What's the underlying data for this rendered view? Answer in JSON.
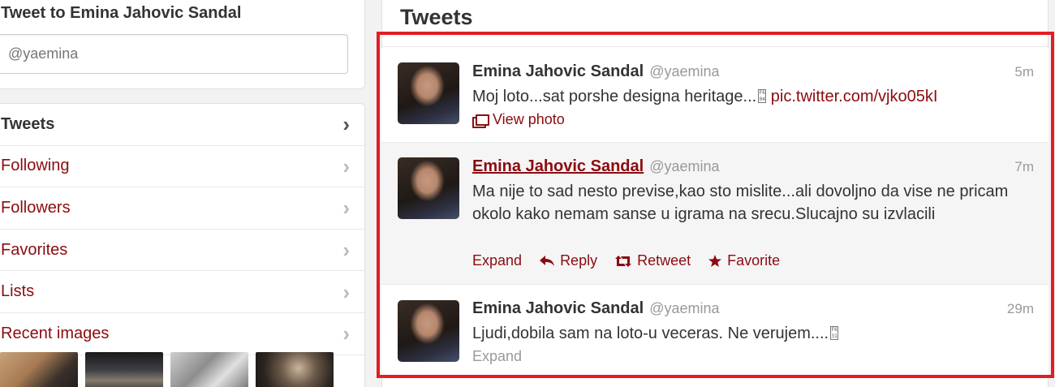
{
  "compose": {
    "title": "Tweet to Emina Jahovic Sandal",
    "placeholder": "@yaemina"
  },
  "nav": {
    "items": [
      {
        "label": "Tweets",
        "active": true
      },
      {
        "label": "Following",
        "active": false
      },
      {
        "label": "Followers",
        "active": false
      },
      {
        "label": "Favorites",
        "active": false
      },
      {
        "label": "Lists",
        "active": false
      },
      {
        "label": "Recent images",
        "active": false
      }
    ]
  },
  "timeline": {
    "title": "Tweets",
    "tweets": [
      {
        "author": "Emina Jahovic Sandal",
        "handle": "@yaemina",
        "time": "5m",
        "text": "Moj loto...sat porshe designa heritage...",
        "glyph": "01F604",
        "link": "pic.twitter.com/vjko05kI",
        "view_photo": "View photo"
      },
      {
        "author": "Emina Jahovic Sandal",
        "handle": "@yaemina",
        "time": "7m",
        "text": "Ma nije to sad nesto previse,kao sto mislite...ali dovoljno da vise ne pricam okolo kako nemam sanse u igrama na srecu.Slucajno su izvlacili",
        "actions": {
          "expand": "Expand",
          "reply": "Reply",
          "retweet": "Retweet",
          "favorite": "Favorite"
        }
      },
      {
        "author": "Emina Jahovic Sandal",
        "handle": "@yaemina",
        "time": "29m",
        "text": "Ljudi,dobila sam na loto-u veceras. Ne verujem....",
        "glyph": "01F631",
        "expand": "Expand"
      }
    ]
  },
  "colors": {
    "link": "#8b0b10",
    "highlight_frame": "#e11d26",
    "hover_row": "#f5f5f5"
  }
}
